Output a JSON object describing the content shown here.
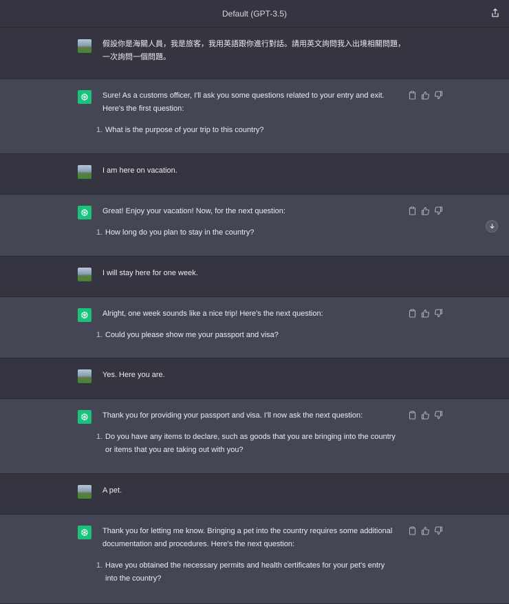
{
  "header": {
    "title": "Default (GPT-3.5)",
    "share_icon": "share-icon"
  },
  "messages": [
    {
      "role": "user",
      "text": "假設你是海關人員，我是旅客，我用英語跟你進行對話。請用英文詢問我入出境相關問題，一次詢問一個問題。"
    },
    {
      "role": "assistant",
      "text": "Sure! As a customs officer, I'll ask you some questions related to your entry and exit. Here's the first question:",
      "list": [
        {
          "num": "1.",
          "text": "What is the purpose of your trip to this country?"
        }
      ]
    },
    {
      "role": "user",
      "text": "I am here on vacation."
    },
    {
      "role": "assistant",
      "text": "Great! Enjoy your vacation! Now, for the next question:",
      "list": [
        {
          "num": "1.",
          "text": "How long do you plan to stay in the country?"
        }
      ]
    },
    {
      "role": "user",
      "text": "I will stay here for one week."
    },
    {
      "role": "assistant",
      "text": "Alright, one week sounds like a nice trip! Here's the next question:",
      "list": [
        {
          "num": "1.",
          "text": "Could you please show me your passport and visa?"
        }
      ]
    },
    {
      "role": "user",
      "text": "Yes. Here you are."
    },
    {
      "role": "assistant",
      "text": "Thank you for providing your passport and visa. I'll now ask the next question:",
      "list": [
        {
          "num": "1.",
          "text": "Do you have any items to declare, such as goods that you are bringing into the country or items that you are taking out with you?"
        }
      ]
    },
    {
      "role": "user",
      "text": "A pet."
    },
    {
      "role": "assistant",
      "text": "Thank you for letting me know. Bringing a pet into the country requires some additional documentation and procedures. Here's the next question:",
      "list": [
        {
          "num": "1.",
          "text": "Have you obtained the necessary permits and health certificates for your pet's entry into the country?"
        }
      ]
    }
  ],
  "icons": {
    "copy": "clipboard-icon",
    "like": "thumbs-up-icon",
    "dislike": "thumbs-down-icon",
    "scroll": "arrow-down-icon"
  },
  "colors": {
    "background": "#343541",
    "assistant_bg": "#444654",
    "bot_avatar": "#19c37d"
  }
}
